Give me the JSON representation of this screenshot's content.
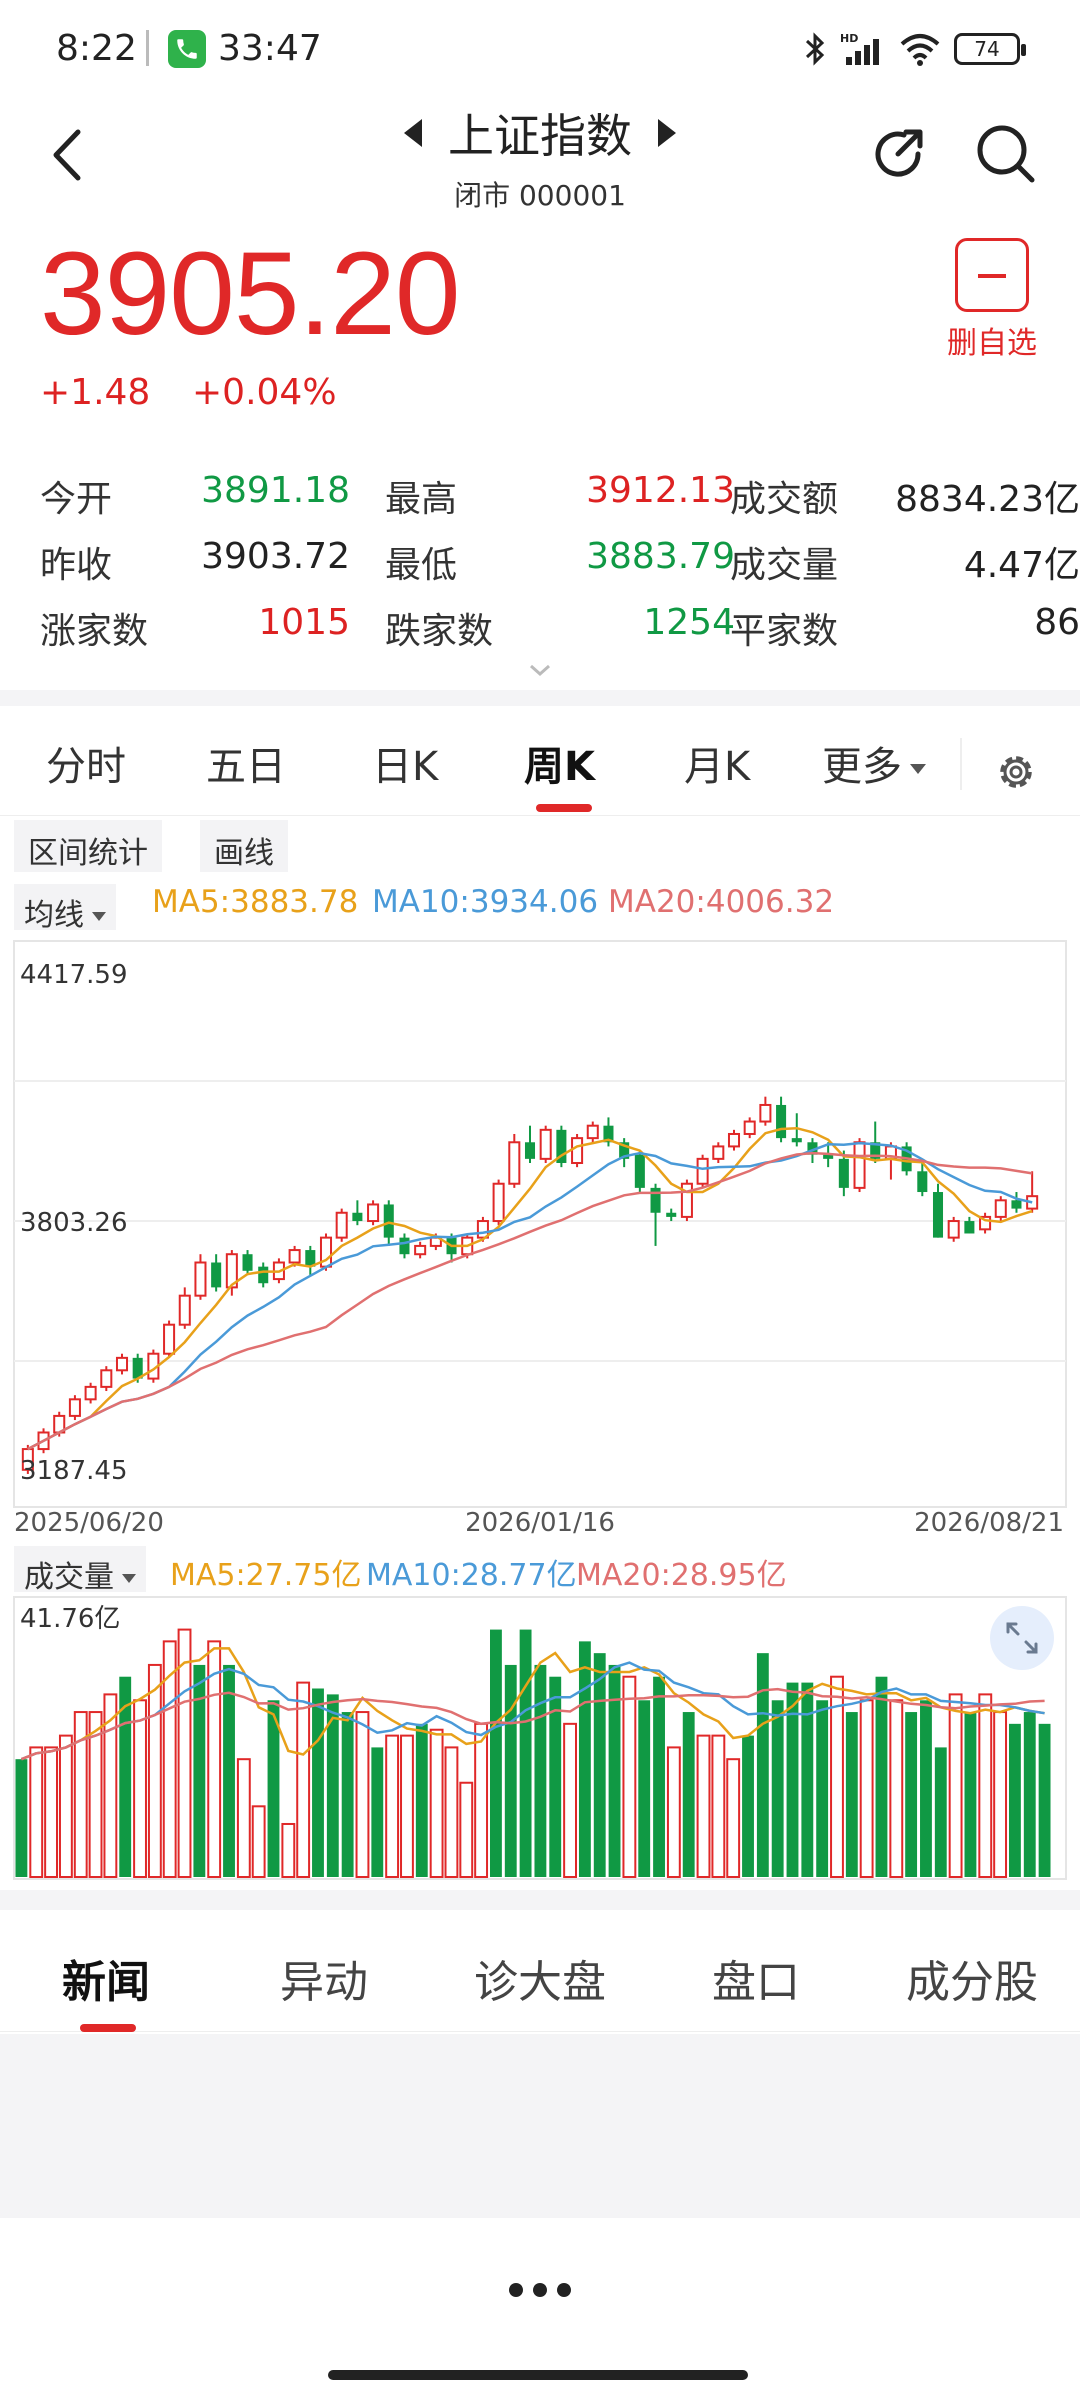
{
  "status_bar": {
    "time": "8:22",
    "call_duration": "33:47",
    "network": "HD",
    "battery": "74"
  },
  "header": {
    "title": "上证指数",
    "subtitle": "闭市 000001"
  },
  "quote": {
    "price": "3905.20",
    "change": "+1.48",
    "change_pct": "+0.04%",
    "remove_favorite_label": "删自选"
  },
  "stats": [
    [
      {
        "label": "今开",
        "value": "3891.18",
        "color": "green"
      },
      {
        "label": "最高",
        "value": "3912.13",
        "color": "red"
      },
      {
        "label": "成交额",
        "value": "8834.23亿",
        "color": "dark"
      }
    ],
    [
      {
        "label": "昨收",
        "value": "3903.72",
        "color": "dark"
      },
      {
        "label": "最低",
        "value": "3883.79",
        "color": "green"
      },
      {
        "label": "成交量",
        "value": "4.47亿",
        "color": "dark"
      }
    ],
    [
      {
        "label": "涨家数",
        "value": "1015",
        "color": "red"
      },
      {
        "label": "跌家数",
        "value": "1254",
        "color": "green"
      },
      {
        "label": "平家数",
        "value": "86",
        "color": "dark"
      }
    ]
  ],
  "tabs": {
    "items": [
      "分时",
      "五日",
      "日K",
      "周K",
      "月K",
      "更多"
    ],
    "active": "周K"
  },
  "chart_tools": {
    "range_stats": "区间统计",
    "draw_line": "画线",
    "indicator_select": "均线",
    "ma5": "MA5:3883.78",
    "ma10": "MA10:3934.06",
    "ma20": "MA20:4006.32"
  },
  "volume": {
    "select": "成交量",
    "ma5": "MA5:27.75亿",
    "ma10": "MA10:28.77亿",
    "ma20": "MA20:28.95亿",
    "max_label": "41.76亿"
  },
  "colors": {
    "up": "#e02828",
    "down": "#109944",
    "ma5": "#e8a11a",
    "ma10": "#4a9ad8",
    "ma20": "#e07070"
  },
  "chart_data": {
    "type": "candlestick",
    "y_ticks": [
      "4417.59",
      "3803.26",
      "3187.45"
    ],
    "ylim": [
      3187.45,
      4417.59
    ],
    "x_ticks": [
      "2025/06/20",
      "2026/01/16",
      "2026/08/21"
    ],
    "candles": [
      [
        3200,
        3250,
        3190,
        3260
      ],
      [
        3250,
        3290,
        3240,
        3300
      ],
      [
        3290,
        3330,
        3280,
        3340
      ],
      [
        3330,
        3370,
        3320,
        3380
      ],
      [
        3370,
        3400,
        3360,
        3410
      ],
      [
        3400,
        3440,
        3390,
        3450
      ],
      [
        3440,
        3470,
        3430,
        3480
      ],
      [
        3470,
        3420,
        3410,
        3480
      ],
      [
        3420,
        3480,
        3410,
        3490
      ],
      [
        3480,
        3550,
        3470,
        3560
      ],
      [
        3550,
        3620,
        3540,
        3640
      ],
      [
        3620,
        3700,
        3610,
        3720
      ],
      [
        3700,
        3640,
        3630,
        3720
      ],
      [
        3640,
        3720,
        3620,
        3730
      ],
      [
        3720,
        3680,
        3670,
        3730
      ],
      [
        3690,
        3650,
        3640,
        3700
      ],
      [
        3660,
        3700,
        3650,
        3710
      ],
      [
        3700,
        3730,
        3690,
        3740
      ],
      [
        3730,
        3690,
        3670,
        3740
      ],
      [
        3690,
        3760,
        3680,
        3770
      ],
      [
        3760,
        3820,
        3750,
        3830
      ],
      [
        3820,
        3800,
        3790,
        3850
      ],
      [
        3800,
        3840,
        3790,
        3850
      ],
      [
        3840,
        3760,
        3740,
        3850
      ],
      [
        3760,
        3720,
        3710,
        3770
      ],
      [
        3720,
        3740,
        3710,
        3750
      ],
      [
        3740,
        3760,
        3730,
        3770
      ],
      [
        3760,
        3720,
        3700,
        3770
      ],
      [
        3720,
        3760,
        3710,
        3770
      ],
      [
        3760,
        3800,
        3750,
        3810
      ],
      [
        3800,
        3890,
        3790,
        3900
      ],
      [
        3890,
        3990,
        3880,
        4010
      ],
      [
        3990,
        3950,
        3940,
        4030
      ],
      [
        3950,
        4020,
        3940,
        4030
      ],
      [
        4020,
        3940,
        3930,
        4030
      ],
      [
        3940,
        4000,
        3930,
        4010
      ],
      [
        4000,
        4030,
        3990,
        4040
      ],
      [
        4030,
        3990,
        3980,
        4050
      ],
      [
        3990,
        3950,
        3930,
        4000
      ],
      [
        3960,
        3880,
        3870,
        3970
      ],
      [
        3880,
        3820,
        3740,
        3890
      ],
      [
        3820,
        3810,
        3800,
        3830
      ],
      [
        3810,
        3890,
        3800,
        3900
      ],
      [
        3890,
        3950,
        3880,
        3960
      ],
      [
        3950,
        3980,
        3940,
        3990
      ],
      [
        3980,
        4010,
        3970,
        4020
      ],
      [
        4010,
        4040,
        4000,
        4050
      ],
      [
        4040,
        4080,
        4030,
        4100
      ],
      [
        4080,
        4000,
        3990,
        4100
      ],
      [
        4000,
        3990,
        3980,
        4060
      ],
      [
        3990,
        3960,
        3940,
        4000
      ],
      [
        3960,
        3950,
        3930,
        3990
      ],
      [
        3950,
        3880,
        3860,
        3970
      ],
      [
        3880,
        3990,
        3870,
        4000
      ],
      [
        3990,
        3950,
        3940,
        4040
      ],
      [
        3950,
        3980,
        3900,
        3990
      ],
      [
        3980,
        3920,
        3910,
        3990
      ],
      [
        3920,
        3870,
        3860,
        3940
      ],
      [
        3870,
        3760,
        3760,
        3890
      ],
      [
        3760,
        3800,
        3750,
        3810
      ],
      [
        3800,
        3770,
        3770,
        3810
      ],
      [
        3780,
        3810,
        3770,
        3820
      ],
      [
        3810,
        3850,
        3800,
        3860
      ],
      [
        3850,
        3830,
        3820,
        3870
      ],
      [
        3830,
        3860,
        3820,
        3920
      ]
    ],
    "volumes": [
      [
        20,
        0
      ],
      [
        22,
        1
      ],
      [
        22,
        1
      ],
      [
        24,
        1
      ],
      [
        28,
        1
      ],
      [
        28,
        1
      ],
      [
        31,
        1
      ],
      [
        34,
        0
      ],
      [
        30,
        1
      ],
      [
        36,
        1
      ],
      [
        40,
        1
      ],
      [
        42,
        1
      ],
      [
        36,
        0
      ],
      [
        40,
        1
      ],
      [
        36,
        0
      ],
      [
        20,
        1
      ],
      [
        12,
        1
      ],
      [
        30,
        0
      ],
      [
        9,
        1
      ],
      [
        33,
        1
      ],
      [
        32,
        0
      ],
      [
        31,
        0
      ],
      [
        28,
        0
      ],
      [
        28,
        1
      ],
      [
        22,
        0
      ],
      [
        24,
        1
      ],
      [
        24,
        1
      ],
      [
        26,
        0
      ],
      [
        25,
        1
      ],
      [
        22,
        1
      ],
      [
        16,
        1
      ],
      [
        26,
        1
      ],
      [
        42,
        0
      ],
      [
        36,
        0
      ],
      [
        42,
        0
      ],
      [
        36,
        0
      ],
      [
        34,
        0
      ],
      [
        26,
        1
      ],
      [
        40,
        0
      ],
      [
        38,
        0
      ],
      [
        36,
        0
      ],
      [
        34,
        1
      ],
      [
        30,
        0
      ],
      [
        34,
        0
      ],
      [
        22,
        1
      ],
      [
        28,
        0
      ],
      [
        24,
        1
      ],
      [
        24,
        1
      ],
      [
        20,
        1
      ],
      [
        24,
        0
      ],
      [
        38,
        0
      ],
      [
        30,
        0
      ],
      [
        33,
        0
      ],
      [
        33,
        0
      ],
      [
        30,
        0
      ],
      [
        34,
        1
      ],
      [
        28,
        0
      ],
      [
        30,
        1
      ],
      [
        34,
        0
      ],
      [
        30,
        1
      ],
      [
        28,
        0
      ],
      [
        30,
        0
      ],
      [
        22,
        0
      ],
      [
        31,
        1
      ],
      [
        28,
        0
      ],
      [
        31,
        1
      ],
      [
        28,
        1
      ],
      [
        26,
        0
      ],
      [
        28,
        0
      ],
      [
        26,
        0
      ]
    ],
    "vol_max": 41.76
  },
  "bottom_tabs": {
    "items": [
      "新闻",
      "异动",
      "诊大盘",
      "盘口",
      "成分股"
    ],
    "active": "新闻"
  }
}
